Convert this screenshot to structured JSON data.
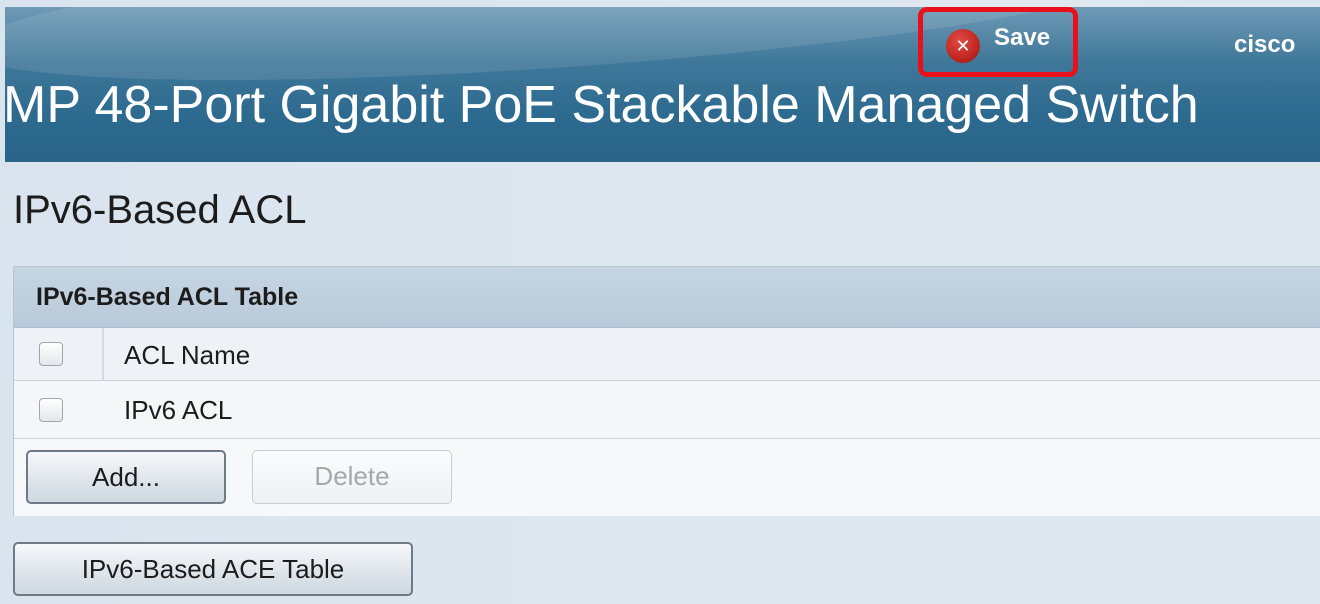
{
  "header": {
    "title": "MP 48-Port Gigabit PoE Stackable Managed Switch",
    "save_label": "Save",
    "save_icon": "close-icon",
    "brand": "cisco"
  },
  "main": {
    "page_title": "IPv6-Based ACL",
    "table": {
      "caption": "IPv6-Based ACL Table",
      "columns": [
        "ACL Name"
      ],
      "rows": [
        {
          "acl_name": "IPv6 ACL",
          "checked": false
        }
      ]
    },
    "buttons": {
      "add": "Add...",
      "delete": "Delete"
    },
    "ace_table_button": "IPv6-Based ACE Table"
  },
  "colors": {
    "header_blue": "#2d6a8f",
    "save_highlight": "#e8111b",
    "save_icon_red": "#c42a23"
  }
}
